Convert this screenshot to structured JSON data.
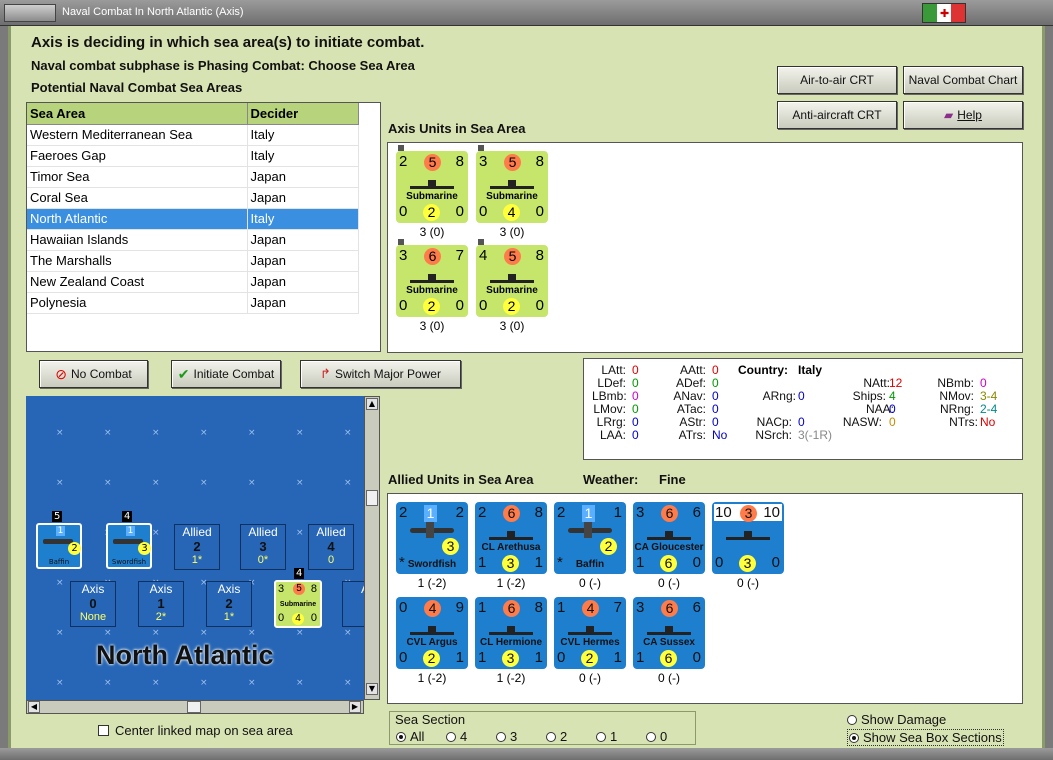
{
  "window": {
    "title": "Naval Combat In North Atlantic (Axis)"
  },
  "header": {
    "status": "Axis is deciding in which sea area(s) to initiate combat.",
    "subphase": "Naval combat subphase is Phasing Combat: Choose Sea Area",
    "potential_label": "Potential Naval Combat Sea Areas"
  },
  "sea_table": {
    "columns": [
      "Sea Area",
      "Decider"
    ],
    "rows": [
      [
        "Western Mediterranean Sea",
        "Italy"
      ],
      [
        "Faeroes Gap",
        "Italy"
      ],
      [
        "Timor Sea",
        "Japan"
      ],
      [
        "Coral Sea",
        "Japan"
      ],
      [
        "North Atlantic",
        "Italy"
      ],
      [
        "Hawaiian Islands",
        "Japan"
      ],
      [
        "The Marshalls",
        "Japan"
      ],
      [
        "New Zealand Coast",
        "Japan"
      ],
      [
        "Polynesia",
        "Japan"
      ]
    ],
    "selected": "North Atlantic"
  },
  "buttons": {
    "air_to_air": "Air-to-air CRT",
    "naval_chart": "Naval Combat Chart",
    "anti_aircraft": "Anti-aircraft CRT",
    "help": "Help",
    "no_combat": "No Combat",
    "initiate": "Initiate Combat",
    "switch_power": "Switch Major Power"
  },
  "axis_units": {
    "label": "Axis Units in Sea Area",
    "units": [
      {
        "tl": "2",
        "tc": "5",
        "tr": "8",
        "name": "Submarine",
        "bl": "0",
        "bc": "2",
        "br": "0",
        "sub": "3 (0)"
      },
      {
        "tl": "3",
        "tc": "5",
        "tr": "8",
        "name": "Submarine",
        "bl": "0",
        "bc": "4",
        "br": "0",
        "sub": "3 (0)"
      },
      {
        "tl": "3",
        "tc": "6",
        "tr": "7",
        "name": "Submarine",
        "bl": "0",
        "bc": "2",
        "br": "0",
        "sub": "3 (0)"
      },
      {
        "tl": "4",
        "tc": "5",
        "tr": "8",
        "name": "Submarine",
        "bl": "0",
        "bc": "2",
        "br": "0",
        "sub": "3 (0)"
      }
    ]
  },
  "stats": {
    "country_label": "Country:",
    "country": "Italy",
    "LAtt": "0",
    "LDef": "0",
    "LBmb": "0",
    "LMov": "0",
    "LRrg": "0",
    "LAA": "0",
    "AAtt": "0",
    "ADef": "0",
    "ANav": "0",
    "ATac": "0",
    "AStr": "0",
    "ATrs": "No",
    "ARng": "0",
    "NACp": "0",
    "NSrch": "3(-1R)",
    "NAtt": "12",
    "Ships": "4",
    "NAA": "0",
    "NASW": "0",
    "NBmb": "0",
    "NMov": "3-4",
    "NRng": "2-4",
    "NTrs": "No"
  },
  "allied_units": {
    "label": "Allied Units in Sea Area",
    "weather_label": "Weather:",
    "weather": "Fine",
    "units": [
      {
        "tl": "2",
        "tc": "1",
        "tr": "2",
        "name": "Swordfish",
        "bl": "*",
        "bc": "3",
        "br": "",
        "sub": "1 (-2)",
        "kind": "plane"
      },
      {
        "tl": "2",
        "tc": "6",
        "tr": "8",
        "name": "CL Arethusa",
        "bl": "1",
        "bc": "3",
        "br": "1",
        "sub": "1 (-2)",
        "kind": "ship"
      },
      {
        "tl": "2",
        "tc": "1",
        "tr": "1",
        "name": "Baffin",
        "bl": "*",
        "bc": "2",
        "br": "",
        "sub": "0 (-)",
        "kind": "plane"
      },
      {
        "tl": "3",
        "tc": "6",
        "tr": "6",
        "name": "CA Gloucester",
        "bl": "1",
        "bc": "6",
        "br": "0",
        "sub": "0 (-)",
        "kind": "ship"
      },
      {
        "tl": "10",
        "tc": "3",
        "tr": "10",
        "name": "",
        "bl": "0",
        "bc": "3",
        "br": "0",
        "sub": "0 (-)",
        "kind": "ship"
      },
      {
        "tl": "0",
        "tc": "4",
        "tr": "9",
        "name": "CVL Argus",
        "bl": "0",
        "bc": "2",
        "br": "1",
        "sub": "1 (-2)",
        "kind": "ship"
      },
      {
        "tl": "1",
        "tc": "6",
        "tr": "8",
        "name": "CL Hermione",
        "bl": "1",
        "bc": "3",
        "br": "1",
        "sub": "1 (-2)",
        "kind": "ship"
      },
      {
        "tl": "1",
        "tc": "4",
        "tr": "7",
        "name": "CVL Hermes",
        "bl": "0",
        "bc": "2",
        "br": "1",
        "sub": "0 (-)",
        "kind": "ship"
      },
      {
        "tl": "3",
        "tc": "6",
        "tr": "6",
        "name": "CA Sussex",
        "bl": "1",
        "bc": "6",
        "br": "0",
        "sub": "0 (-)",
        "kind": "ship"
      }
    ]
  },
  "map": {
    "name": "North Atlantic",
    "allied_boxes": [
      {
        "side": "Allied",
        "num": "2",
        "val": "1*"
      },
      {
        "side": "Allied",
        "num": "3",
        "val": "0*"
      },
      {
        "side": "Allied",
        "num": "4",
        "val": "0"
      }
    ],
    "axis_boxes": [
      {
        "side": "Axis",
        "num": "0",
        "val": "None"
      },
      {
        "side": "Axis",
        "num": "1",
        "val": "2*"
      },
      {
        "side": "Axis",
        "num": "2",
        "val": "1*"
      }
    ],
    "axis_box_partial": "A",
    "counters": [
      {
        "stack": "5",
        "name": "Baffin",
        "val": "2",
        "top": "1"
      },
      {
        "stack": "4",
        "name": "Swordfish",
        "val": "3",
        "top": "1"
      },
      {
        "stack": "4",
        "name": "Submarine",
        "tl": "3",
        "tc": "5",
        "tr": "8",
        "bl": "0",
        "bc": "4",
        "br": "0"
      }
    ],
    "center_label": "Center linked map on sea area"
  },
  "sea_section": {
    "label": "Sea Section",
    "options": [
      "All",
      "4",
      "3",
      "2",
      "1",
      "0"
    ],
    "selected": "All"
  },
  "options": {
    "show_damage": "Show Damage",
    "show_sections": "Show Sea Box Sections",
    "selected": "Show Sea Box Sections"
  },
  "colors": {
    "axis_counter": "#c5e66b",
    "allied_counter": "#1f7fcf",
    "selection": "#3b8fe0",
    "panel_bg": "#d8e3b4"
  }
}
